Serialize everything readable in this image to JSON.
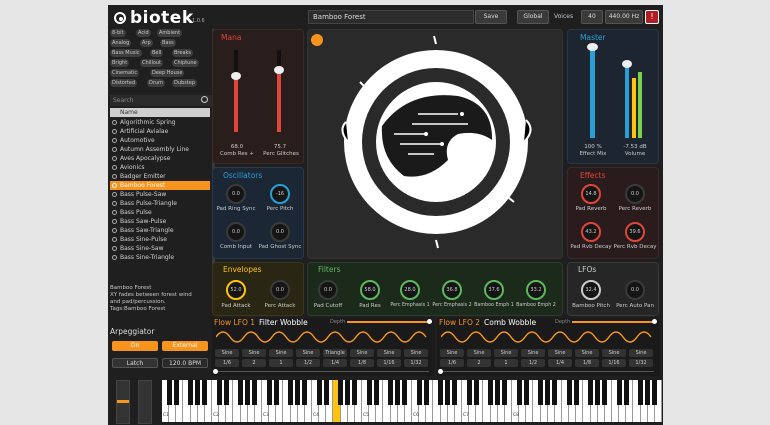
{
  "app": {
    "name": "biotek",
    "version": "1.0.6"
  },
  "topbar": {
    "preset": "Bamboo Forest",
    "save_label": "Save",
    "global_label": "Global",
    "voices_label": "Voices",
    "voices_value": "40",
    "tuning_value": "440.00 Hz",
    "warning_label": "!"
  },
  "tags": [
    "8-bit",
    "Acid",
    "Ambient",
    "Analog",
    "Arp",
    "Bass",
    "Bass Music",
    "Bell",
    "Breaks",
    "Bright",
    "Chillout",
    "Chiptune",
    "Cinematic",
    "Deep House",
    "Distorted",
    "Drum",
    "Dubstep"
  ],
  "search": {
    "placeholder": "Search"
  },
  "browser": {
    "column_header": "Name",
    "items": [
      "Algorithmic Spring",
      "Artificial Avialae",
      "Automotive",
      "Autumn Assembly Line",
      "Aves Apocalypse",
      "Avionics",
      "Badger Emitter",
      "Bamboo Forest",
      "Bass Pulse-Saw",
      "Bass Pulse-Triangle",
      "Bass Pulse",
      "Bass Saw-Pulse",
      "Bass Saw-Triangle",
      "Bass Sine-Pulse",
      "Bass Sine-Saw",
      "Bass Sine-Triangle"
    ],
    "selected_index": 7
  },
  "description": {
    "line1": "Bamboo Forest",
    "line2": "XY fades between forest wind",
    "line3": "and pad/percussion.",
    "line4": "Tags:Bamboo Forest"
  },
  "mana": {
    "title": "Mana",
    "sliders": [
      {
        "value": "68.0",
        "label": "Comb Res +",
        "level": 0.68
      },
      {
        "value": "75.7",
        "label": "Perc Glitches",
        "level": 0.757
      }
    ]
  },
  "master": {
    "title": "Master",
    "effect_mix": {
      "value": "100 %",
      "label": "Effect Mix",
      "level": 1.0
    },
    "volume": {
      "value": "-7.53 dB",
      "label": "Volume",
      "level": 0.72
    }
  },
  "oscillators": {
    "title": "Oscillators",
    "knobs": [
      {
        "value": "0.0",
        "label": "Pad Ring Sync"
      },
      {
        "value": "-16",
        "label": "Perc Pitch"
      },
      {
        "value": "0.0",
        "label": "Comb Input"
      },
      {
        "value": "0.0",
        "label": "Pad Ghost Sync"
      }
    ]
  },
  "effects": {
    "title": "Effects",
    "knobs": [
      {
        "value": "14.8",
        "label": "Pad Reverb"
      },
      {
        "value": "0.0",
        "label": "Perc Reverb"
      },
      {
        "value": "43.2",
        "label": "Pad Rvb Decay"
      },
      {
        "value": "39.6",
        "label": "Perc Rvb Decay"
      }
    ]
  },
  "envelopes": {
    "title": "Envelopes",
    "knobs": [
      {
        "value": "52.0",
        "label": "Pad Attack"
      },
      {
        "value": "0.0",
        "label": "Perc Attack"
      }
    ]
  },
  "filters": {
    "title": "Filters",
    "knobs": [
      {
        "value": "0.0",
        "label": "Pad Cutoff"
      },
      {
        "value": "58.0",
        "label": "Pad Res"
      },
      {
        "value": "28.0",
        "label": "Perc Emphasis 1"
      },
      {
        "value": "36.8",
        "label": "Perc Emphasis 2"
      },
      {
        "value": "37.6",
        "label": "Bamboo Emph 1"
      },
      {
        "value": "33.2",
        "label": "Bamboo Emph 2"
      }
    ]
  },
  "lfos": {
    "title": "LFOs",
    "knobs": [
      {
        "value": "32.4",
        "label": "Bamboo Pitch"
      },
      {
        "value": "0.0",
        "label": "Perc Auto Pan"
      }
    ]
  },
  "flow_lfo_1": {
    "title": "Flow LFO 1",
    "name": "Filter Wobble",
    "depth_label": "Depth",
    "shapes": [
      "Sine",
      "Sine",
      "Sine",
      "Sine",
      "Triangle",
      "Sine",
      "Sine",
      "Sine"
    ],
    "rates": [
      "1/6",
      "2",
      "1",
      "1/2",
      "1/4",
      "1/8",
      "1/16",
      "1/32"
    ]
  },
  "flow_lfo_2": {
    "title": "Flow LFO 2",
    "name": "Comb Wobble",
    "depth_label": "Depth",
    "shapes": [
      "Sine",
      "Sine",
      "Sine",
      "Sine",
      "Sine",
      "Sine",
      "Sine",
      "Sine"
    ],
    "rates": [
      "1/6",
      "2",
      "1",
      "1/2",
      "1/4",
      "1/8",
      "1/16",
      "1/32"
    ]
  },
  "arpeggiator": {
    "title": "Arpeggiator",
    "on_label": "On",
    "external_label": "External",
    "latch_label": "Latch",
    "bpm_value": "120.0 BPM"
  },
  "keyboard": {
    "octave_labels": [
      "C1",
      "C2",
      "C3",
      "C4",
      "C5",
      "C6",
      "C7",
      "C8"
    ],
    "highlight_key": "F4"
  },
  "colors": {
    "accent": "#f7941e",
    "mana_red": "#e0453a",
    "master_blue": "#2a9fd6",
    "effects_red": "#e0453a",
    "envelope_yellow": "#ffc20e",
    "filter_green": "#5cb85c",
    "selection": "#f7941e"
  }
}
